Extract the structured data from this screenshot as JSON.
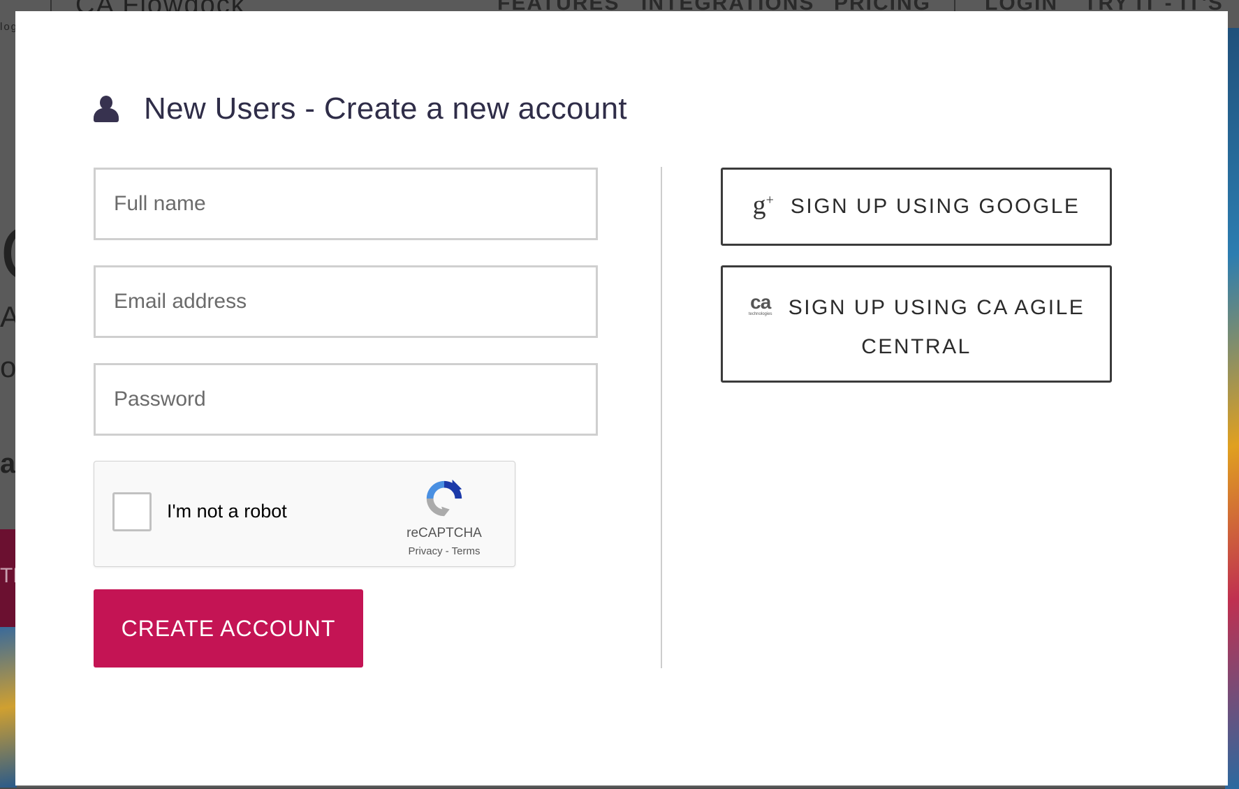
{
  "background": {
    "brand": "CA Flowdock",
    "brand_sub": "log",
    "nav": [
      "FEATURES",
      "INTEGRATIONS",
      "PRICING",
      "LOGIN",
      "TRY IT - IT'S F"
    ],
    "fragments": [
      "C",
      "A F",
      "ob",
      "al",
      "TR"
    ]
  },
  "modal": {
    "title": "New Users - Create a new account",
    "title_icon": "user-icon",
    "fields": {
      "full_name_placeholder": "Full name",
      "email_placeholder": "Email address",
      "password_placeholder": "Password"
    },
    "captcha": {
      "label": "I'm not a robot",
      "brand": "reCAPTCHA",
      "links": "Privacy - Terms"
    },
    "create_button": "CREATE ACCOUNT",
    "oauth": {
      "google_label": "SIGN UP USING GOOGLE",
      "google_icon": "google-plus-icon",
      "google_glyph": "g",
      "google_glyph_sup": "+",
      "ca_label": "SIGN UP USING CA AGILE CENTRAL",
      "ca_icon": "ca-technologies-icon",
      "ca_mark": "ca",
      "ca_sub": "technologies"
    }
  },
  "colors": {
    "accent": "#c41454",
    "title": "#2f2d48",
    "border": "#cfcfcf",
    "oauth_border": "#3b3b3b"
  }
}
